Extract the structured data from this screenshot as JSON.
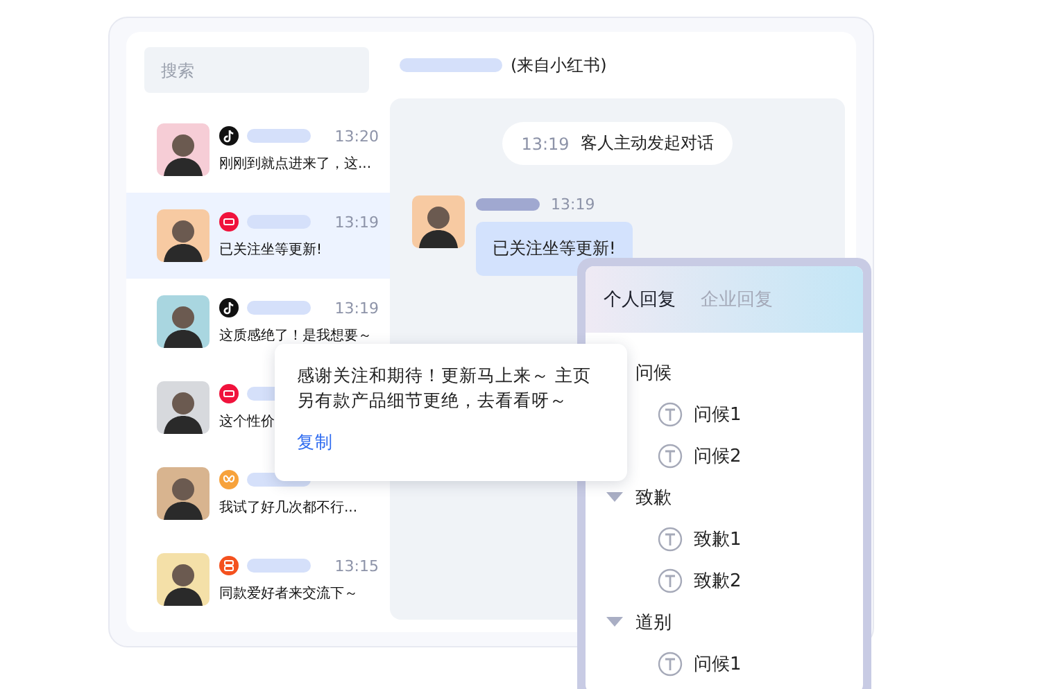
{
  "search": {
    "placeholder": "搜索"
  },
  "conversations": [
    {
      "kind": "note",
      "time": "13:20",
      "preview": "刚刚到就点进来了，这...",
      "selected": false
    },
    {
      "kind": "book",
      "time": "13:19",
      "preview": "已关注坐等更新!",
      "selected": true
    },
    {
      "kind": "note",
      "time": "13:19",
      "preview": "这质感绝了！是我想要～",
      "selected": false
    },
    {
      "kind": "book",
      "preview": "这个性价",
      "selected": false
    },
    {
      "kind": "butterfly",
      "preview": "我试了好几次都不行...",
      "selected": false
    },
    {
      "kind": "grid",
      "time": "13:15",
      "preview": "同款爱好者来交流下～",
      "selected": false
    }
  ],
  "chat": {
    "source": "(来自小红书)",
    "system": {
      "time": "13:19",
      "text": "客人主动发起对话"
    },
    "message": {
      "time": "13:19",
      "text": "已关注坐等更新!"
    }
  },
  "quick_replies": {
    "tabs": [
      {
        "label": "个人回复",
        "selected": true
      },
      {
        "label": "企业回复",
        "selected": false
      }
    ],
    "groups": [
      {
        "label": "问候",
        "expanded": true,
        "children": [
          {
            "label": "问候1"
          },
          {
            "label": "问候2"
          }
        ]
      },
      {
        "label": "致歉",
        "expanded": true,
        "children": [
          {
            "label": "致歉1"
          },
          {
            "label": "致歉2"
          }
        ]
      },
      {
        "label": "道别",
        "expanded": true,
        "children": [
          {
            "label": "问候1"
          }
        ]
      }
    ]
  },
  "popup": {
    "text": "感谢关注和期待！更新马上来～ 主页另有款产品细节更绝，去看看呀～",
    "action": "复制"
  }
}
